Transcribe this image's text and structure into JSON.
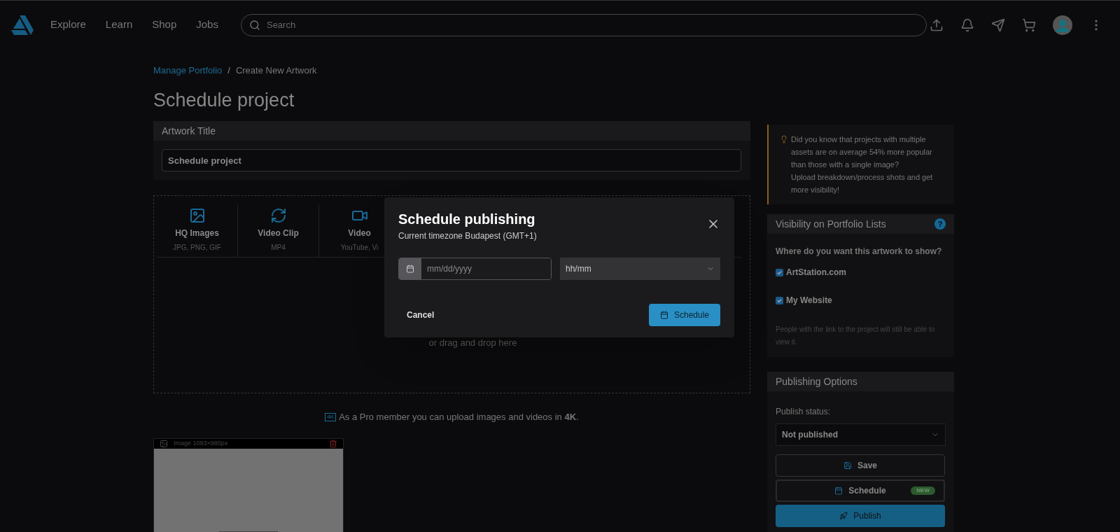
{
  "nav": {
    "links": [
      "Explore",
      "Learn",
      "Shop",
      "Jobs"
    ],
    "search": {
      "placeholder": "Search"
    }
  },
  "breadcrumb": [
    "Manage Portfolio",
    "/",
    "Create New Artwork"
  ],
  "page_title": "Schedule project",
  "artwork_title": {
    "label": "Artwork Title",
    "value": "Schedule project"
  },
  "upload_types": [
    {
      "kind": "image",
      "label": "HQ Images",
      "formats": "JPG, PNG, GIF"
    },
    {
      "kind": "clip",
      "label": "Video Clip",
      "formats": "MP4"
    },
    {
      "kind": "video",
      "label": "Video",
      "formats": "YouTube, Vi"
    }
  ],
  "drop_hint": "or drag and drop here",
  "pro_note": {
    "badge": "4K",
    "text": "As a Pro member you can upload images and videos in **4K**."
  },
  "asset": {
    "label": "Image 1093×980px"
  },
  "tip": "Did you know that projects with multiple assets are on average 54% more popular than those with a single image?\nUpload breakdown/process shots and get more visibility!",
  "visibility": {
    "title": "Visibility on Portfolio Lists",
    "help": "?",
    "question": "Where do you want this artwork to show?",
    "options": [
      {
        "label": "ArtStation.com",
        "checked": true
      },
      {
        "label": "My Website",
        "checked": true
      }
    ],
    "note": "People with the link to the project will still be able to view it."
  },
  "publishing": {
    "title": "Publishing Options",
    "status_label": "Publish status:",
    "status": "Not published",
    "save": "Save",
    "schedule": "Schedule",
    "schedule_badge": "NEW",
    "publish": "Publish"
  },
  "modal": {
    "title": "Schedule publishing",
    "subtitle": "Current timezone Budapest (GMT+1)",
    "date_placeholder": "mm/dd/yyyy",
    "time_value": "hh/mm",
    "cancel": "Cancel",
    "confirm": "Schedule"
  }
}
